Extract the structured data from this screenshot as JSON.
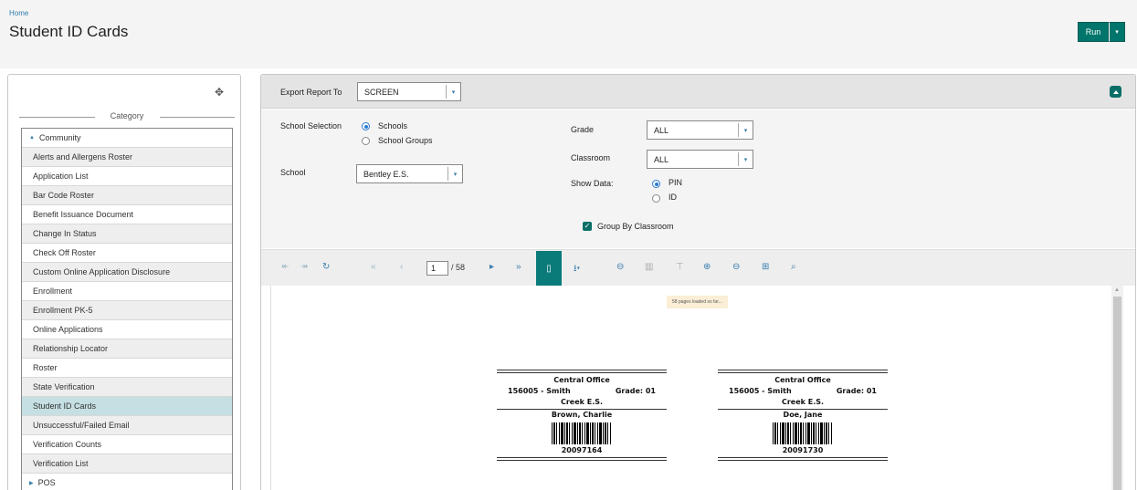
{
  "breadcrumb": "Home",
  "page_title": "Student ID Cards",
  "run_button": {
    "label": "Run",
    "caret": "▾"
  },
  "left_panel": {
    "move_icon": "✥",
    "category_label": "Category",
    "groups_top": {
      "label": "Community",
      "icon": "triangle-up-icon",
      "glyph": "▲"
    },
    "items": [
      "Alerts and Allergens Roster",
      "Application List",
      "Bar Code Roster",
      "Benefit Issuance Document",
      "Change In Status",
      "Check Off Roster",
      "Custom Online Application Disclosure",
      "Enrollment",
      "Enrollment PK-5",
      "Online Applications",
      "Relationship Locator",
      "Roster",
      "State Verification",
      "Student ID Cards",
      "Unsuccessful/Failed Email",
      "Verification Counts",
      "Verification List"
    ],
    "active_item": "Student ID Cards",
    "groups_bottom": {
      "label": "POS",
      "glyph": "▶"
    }
  },
  "export": {
    "label": "Export Report To",
    "value": "SCREEN",
    "caret": "▾"
  },
  "options": {
    "school_selection_label": "School Selection",
    "school_selection_options": [
      "Schools",
      "School Groups"
    ],
    "school_selection_selected": "Schools",
    "school_label": "School",
    "school_value": "Bentley E.S.",
    "grade_label": "Grade",
    "grade_value": "ALL",
    "classroom_label": "Classroom",
    "classroom_value": "ALL",
    "show_data_label": "Show Data:",
    "show_data_options": [
      "PIN",
      "ID"
    ],
    "show_data_selected": "PIN",
    "group_by_label": "Group By Classroom",
    "group_by_checked": true,
    "check_glyph": "✓",
    "select_caret": "▾"
  },
  "viewer": {
    "page_current": "1",
    "page_total": "/ 58",
    "loaded_note": "58 pages loaded so far...",
    "tool_glyphs": {
      "back": "↞",
      "forward": "↠",
      "refresh": "↻",
      "first": "«",
      "prev": "‹",
      "next": "▸",
      "last": "»",
      "document": "▯",
      "export": "⭳▾",
      "print": "⊖",
      "print_layout": "▥",
      "filter": "⊤",
      "zoom_in": "⊕",
      "zoom_out": "⊖",
      "zoom_page": "⊞",
      "search": "⌕"
    },
    "cards": [
      {
        "office": "Central Office",
        "pin_name": "156005 - Smith",
        "grade": "Grade: 01",
        "school": "Creek E.S.",
        "student": "Brown, Charlie",
        "number": "20097164"
      },
      {
        "office": "Central Office",
        "pin_name": "156005 - Smith",
        "grade": "Grade: 01",
        "school": "Creek E.S.",
        "student": "Doe, Jane",
        "number": "20091730"
      }
    ]
  },
  "colors": {
    "accent": "#0b6e67",
    "link": "#2f7fae",
    "active_row": "#c5dfe3",
    "note_bg": "#fbeed6"
  }
}
